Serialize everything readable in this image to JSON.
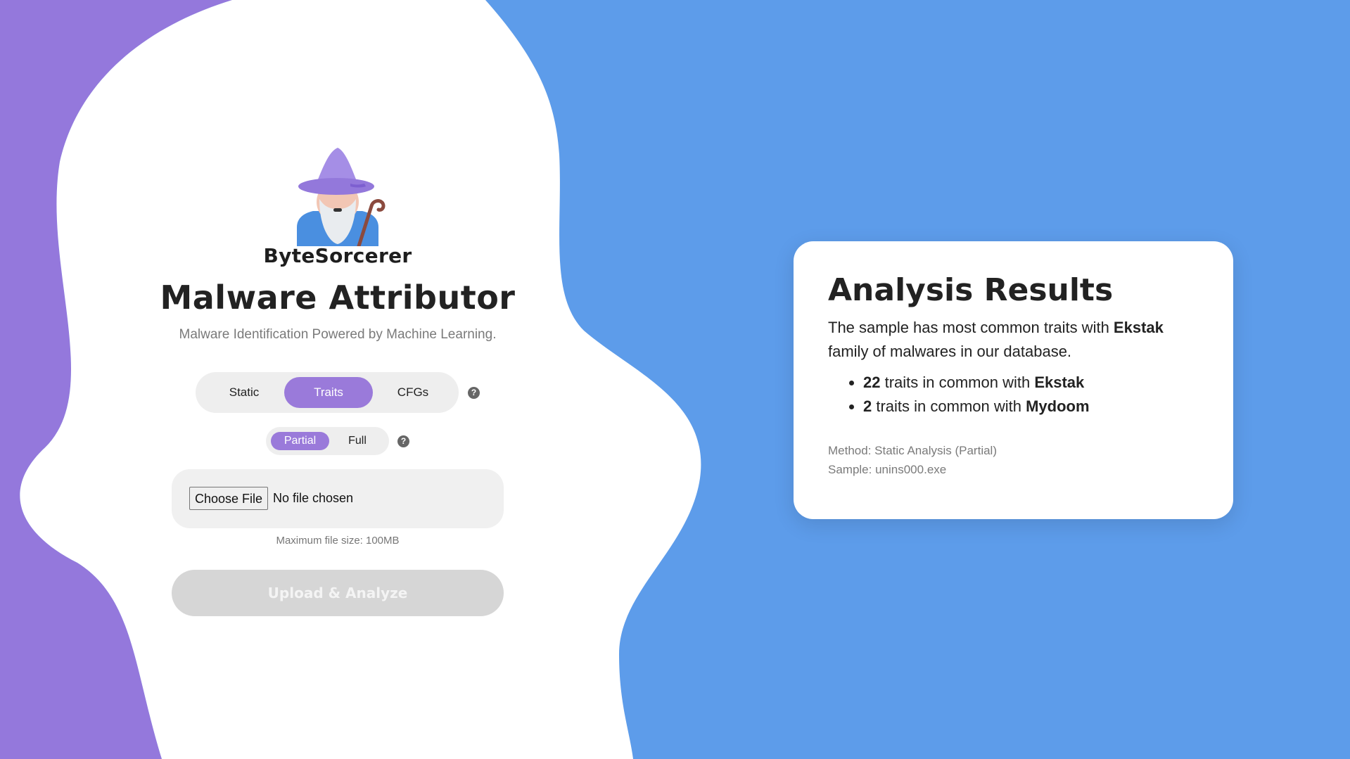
{
  "brand": {
    "name": "ByteSorcerer",
    "logo_icon": "wizard-icon"
  },
  "header": {
    "title": "Malware Attributor",
    "subtitle": "Malware Identification Powered by Machine Learning."
  },
  "analysis_mode": {
    "options": [
      "Static",
      "Traits",
      "CFGs"
    ],
    "selected": "Traits",
    "help_icon": "question-circle-icon"
  },
  "scope_mode": {
    "options": [
      "Partial",
      "Full"
    ],
    "selected": "Partial",
    "help_icon": "question-circle-icon"
  },
  "file_input": {
    "button_label": "Choose File",
    "status": "No file chosen",
    "hint": "Maximum file size: 100MB"
  },
  "upload_button": {
    "label": "Upload & Analyze",
    "disabled": true
  },
  "results": {
    "title": "Analysis Results",
    "summary_prefix": "The sample has most common traits with ",
    "summary_family": "Ekstak",
    "summary_suffix": " family of malwares in our database.",
    "matches": [
      {
        "count": "22",
        "text": " traits in common with ",
        "family": "Ekstak"
      },
      {
        "count": "2",
        "text": " traits in common with ",
        "family": "Mydoom"
      }
    ],
    "method": "Method: Static Analysis (Partial)",
    "sample": "Sample: unins000.exe"
  },
  "colors": {
    "background_blue": "#5d9cea",
    "accent_purple": "#9a7ada",
    "left_purple": "#9478dc"
  }
}
